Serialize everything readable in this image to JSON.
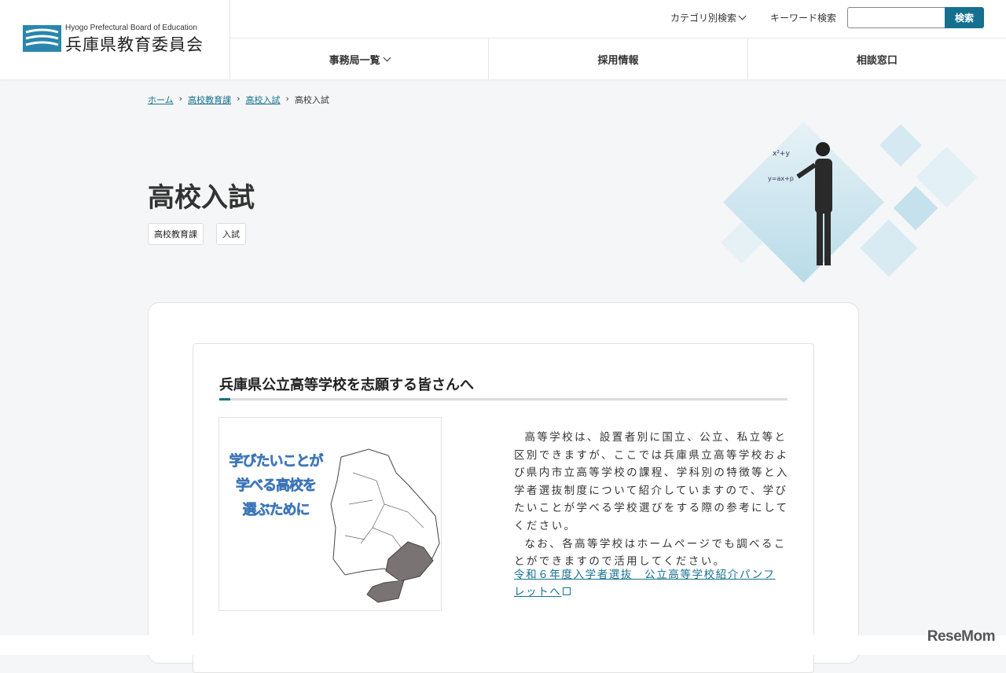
{
  "header": {
    "logo_en": "Hyogo Prefectural Board of Education",
    "logo_jp": "兵庫県教育委員会",
    "category_search": "カテゴリ別検索",
    "keyword_label": "キーワード検索",
    "search_placeholder": "",
    "search_button": "検索"
  },
  "nav": [
    {
      "label": "事務局一覧"
    },
    {
      "label": "採用情報"
    },
    {
      "label": "相談窓口"
    }
  ],
  "breadcrumb": [
    "ホーム",
    "高校教育課",
    "高校入試",
    "高校入試"
  ],
  "page": {
    "title": "高校入試",
    "tags": [
      "高校教育課",
      "入試"
    ]
  },
  "section": {
    "heading": "兵庫県公立高等学校を志願する皆さんへ",
    "image_text": [
      "学びたいことが",
      "学べる高校を",
      "選ぶために"
    ],
    "paragraphs": [
      "高等学校は、設置者別に国立、公立、私立等と区別できますが、ここでは兵庫県立高等学校および県内市立高等学校の課程、学科別の特徴等と入学者選抜制度について紹介していますので、学びたいことが学べる学校選びをする際の参考にしてください。",
      "なお、各高等学校はホームページでも調べることができますので活用してください。"
    ],
    "link": "令和６年度入学者選抜　公立高等学校紹介パンフレットへ"
  },
  "watermark": "ReseMom",
  "colors": {
    "accent": "#15708f",
    "logo": "#2a86ad"
  }
}
